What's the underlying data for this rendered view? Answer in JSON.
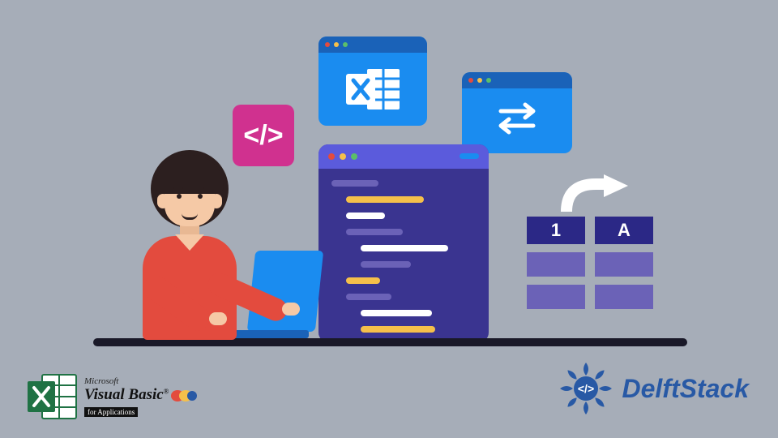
{
  "colors": {
    "background": "#a6adb8",
    "accent_blue": "#1a8cf0",
    "dark_blue": "#1a62b8",
    "purple": "#3a3490",
    "magenta": "#d0318f",
    "red": "#e34b3e"
  },
  "code_tile": {
    "glyph": "</>"
  },
  "cells": {
    "headers": [
      "1",
      "A"
    ]
  },
  "logos": {
    "vba_line1": "Microsoft",
    "vba_line2": "Visual Basic",
    "vba_tm": "®",
    "vba_line3": "for Applications",
    "delftstack": "DelftStack"
  },
  "icons": {
    "code_tile": "code-brackets-icon",
    "excel": "excel-x-icon",
    "transfer": "swap-arrows-icon",
    "arrow": "curved-arrow-icon"
  }
}
